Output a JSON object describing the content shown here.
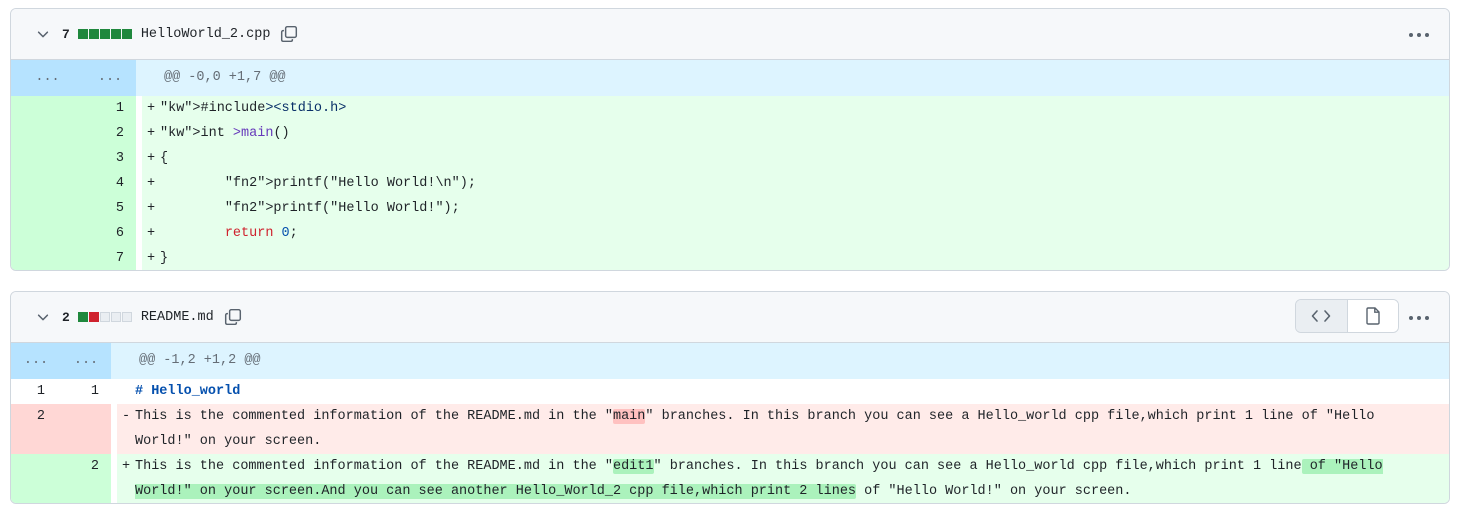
{
  "files": [
    {
      "count": "7",
      "name": "HelloWorld_2.cpp",
      "hunk": {
        "old": "...",
        "new": "...",
        "header": "@@ -0,0 +1,7 @@"
      },
      "lines": [
        {
          "new": "1",
          "sign": "+",
          "code": "#include<stdio.h>"
        },
        {
          "new": "2",
          "sign": "+",
          "code": "int main()"
        },
        {
          "new": "3",
          "sign": "+",
          "code": "{"
        },
        {
          "new": "4",
          "sign": "+",
          "code": "        printf(\"Hello World!\\n\");"
        },
        {
          "new": "5",
          "sign": "+",
          "code": "        printf(\"Hello World!\");"
        },
        {
          "new": "6",
          "sign": "+",
          "code": "        return 0;"
        },
        {
          "new": "7",
          "sign": "+",
          "code": "}"
        }
      ]
    },
    {
      "count": "2",
      "name": "README.md",
      "hunk": {
        "old": "...",
        "new": "...",
        "header": "@@ -1,2 +1,2 @@"
      },
      "lines": [
        {
          "old": "1",
          "new": "1",
          "sign": "",
          "code": "# Hello_world"
        },
        {
          "old": "2",
          "new": "",
          "sign": "-",
          "pre": "This is the commented information of the README.md in the \"",
          "hl": "main",
          "post": "\" branches. In this branch you can see a Hello_world cpp file,which print 1 line of \"Hello World!\" on your screen."
        },
        {
          "old": "",
          "new": "2",
          "sign": "+",
          "pre": "This is the commented information of the README.md in the \"",
          "hl": "edit1",
          "mid": "\" branches. In this branch you can see a Hello_world cpp file,which print 1 line",
          "hl2": " of \"Hello World!\" on your screen.And you can see another Hello_World_2 cpp file,which print 2 lines",
          "post": " of \"Hello World!\" on your screen."
        }
      ]
    }
  ],
  "colors": {
    "added_block": "#1f883d",
    "deleted_block": "#cf222e",
    "hunk_bg": "#ddf4ff",
    "add_bg": "#e6ffec",
    "del_bg": "#ffebe9"
  },
  "icons": {
    "expand": "chevron-down-icon",
    "copy": "copy-icon",
    "more": "kebab-horizontal-icon",
    "code_view": "code-icon",
    "file_view": "file-icon"
  }
}
